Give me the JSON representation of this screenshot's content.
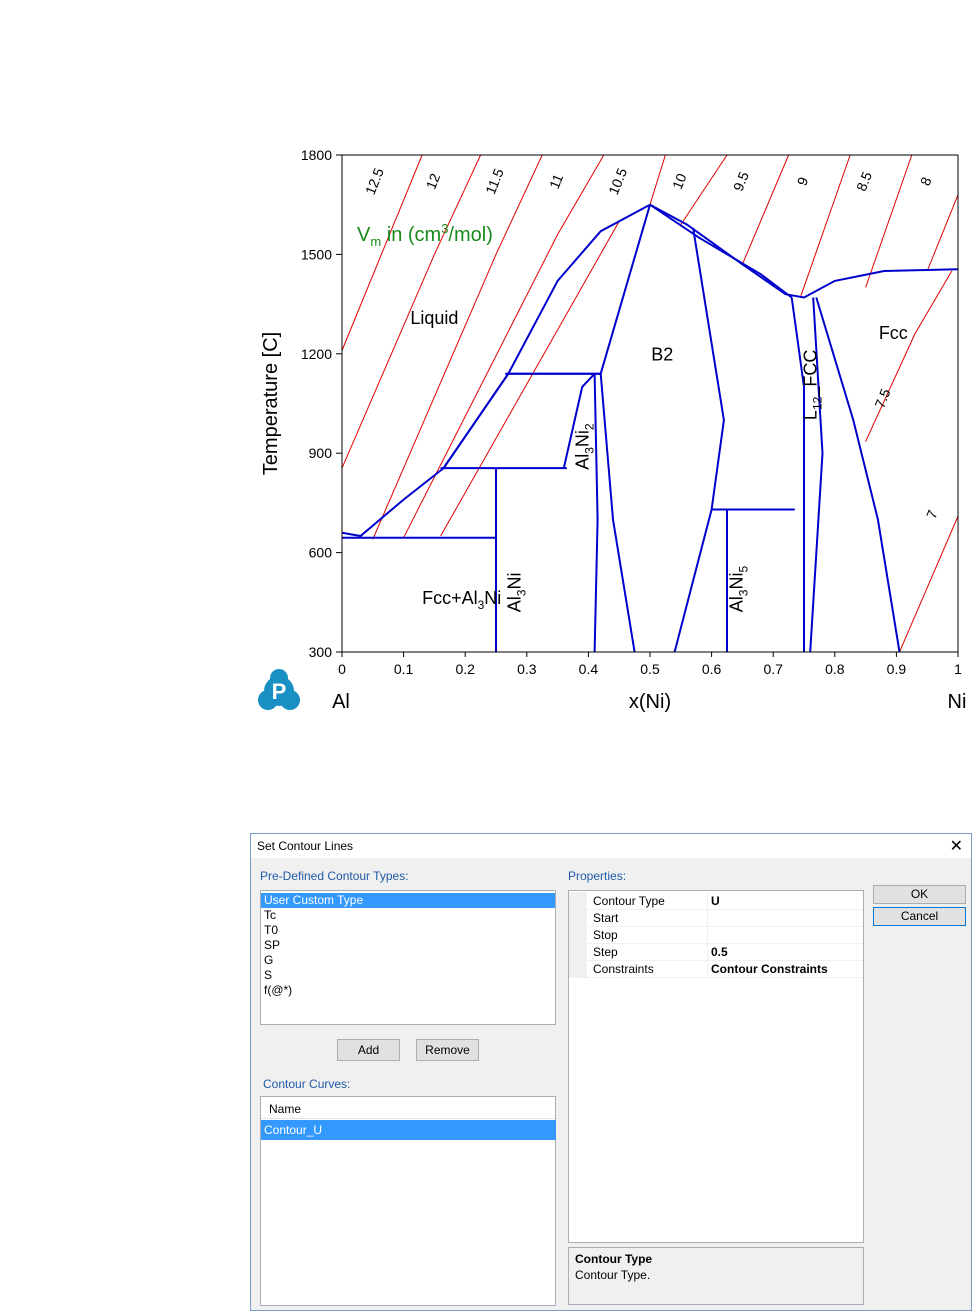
{
  "chart_data": {
    "type": "line",
    "xlabel": "x(Ni)",
    "ylabel": "Temperature [C]",
    "xlim": [
      0,
      1
    ],
    "ylim": [
      300,
      1800
    ],
    "xticks": [
      "0",
      "0.1",
      "0.2",
      "0.3",
      "0.4",
      "0.5",
      "0.6",
      "0.7",
      "0.8",
      "0.9",
      "1"
    ],
    "yticks": [
      "300",
      "600",
      "900",
      "1200",
      "1500",
      "1800"
    ],
    "left_element": "Al",
    "right_element": "Ni",
    "annotation": {
      "prefix": "V",
      "sub": "m",
      "mid": " in (cm",
      "sup": "3",
      "suffix": "/mol)"
    },
    "annotation_color": "#1a8a1a",
    "phase_boundary_color": "#0000cc",
    "contour_color": "#e00000",
    "grid": false,
    "regions": [
      {
        "label": "Liquid",
        "x": 0.15,
        "y": 1290
      },
      {
        "label": "B2",
        "x": 0.52,
        "y": 1180
      },
      {
        "label": "Fcc",
        "x": 0.895,
        "y": 1245
      }
    ],
    "phase_labels": [
      {
        "base": "Fcc+Al",
        "sub": "3",
        "tail": "Ni",
        "x": 0.13,
        "y": 445,
        "rotate": 0
      },
      {
        "base": "Al",
        "sub": "3",
        "tail": "Ni",
        "x": 0.29,
        "y": 420,
        "rotate": -90
      },
      {
        "base": "Al",
        "sub": "3",
        "tail": "Ni",
        "sub2": "2",
        "x": 0.4,
        "y": 850,
        "rotate": -90
      },
      {
        "base": "Al",
        "sub": "3",
        "tail": "Ni",
        "sub2": "5",
        "x": 0.65,
        "y": 420,
        "rotate": -90
      },
      {
        "base": "L",
        "sub": "12",
        "tail": "_FCC",
        "x": 0.77,
        "y": 1000,
        "rotate": -90
      }
    ],
    "contour_labels": [
      {
        "text": "12.5",
        "x": 0.06,
        "y": 1715
      },
      {
        "text": "12",
        "x": 0.155,
        "y": 1715
      },
      {
        "text": "11.5",
        "x": 0.255,
        "y": 1715
      },
      {
        "text": "11",
        "x": 0.355,
        "y": 1715
      },
      {
        "text": "10.5",
        "x": 0.455,
        "y": 1715
      },
      {
        "text": "10",
        "x": 0.555,
        "y": 1715
      },
      {
        "text": "9.5",
        "x": 0.655,
        "y": 1715
      },
      {
        "text": "9",
        "x": 0.755,
        "y": 1715
      },
      {
        "text": "8.5",
        "x": 0.855,
        "y": 1715
      },
      {
        "text": "8",
        "x": 0.955,
        "y": 1715
      },
      {
        "text": "7.5",
        "x": 0.885,
        "y": 1060
      },
      {
        "text": "7",
        "x": 0.965,
        "y": 710
      }
    ],
    "contours": [
      {
        "value": 12.5,
        "points": [
          [
            0,
            1210
          ],
          [
            0.13,
            1800
          ]
        ]
      },
      {
        "value": 12,
        "points": [
          [
            0,
            855
          ],
          [
            0.15,
            1500
          ],
          [
            0.225,
            1800
          ]
        ]
      },
      {
        "value": 11.5,
        "points": [
          [
            0.05,
            640
          ],
          [
            0.25,
            1500
          ],
          [
            0.325,
            1800
          ]
        ]
      },
      {
        "value": 11,
        "points": [
          [
            0.1,
            645
          ],
          [
            0.35,
            1560
          ],
          [
            0.425,
            1800
          ]
        ]
      },
      {
        "value": 10.5,
        "points": [
          [
            0.16,
            650
          ],
          [
            0.45,
            1600
          ],
          [
            0.5,
            1650
          ],
          [
            0.525,
            1800
          ]
        ]
      },
      {
        "value": 10,
        "points": [
          [
            0.55,
            1590
          ],
          [
            0.625,
            1800
          ]
        ]
      },
      {
        "value": 9.5,
        "points": [
          [
            0.65,
            1470
          ],
          [
            0.725,
            1800
          ]
        ]
      },
      {
        "value": 9,
        "points": [
          [
            0.745,
            1375
          ],
          [
            0.825,
            1800
          ]
        ]
      },
      {
        "value": 8.5,
        "points": [
          [
            0.85,
            1400
          ],
          [
            0.925,
            1800
          ]
        ]
      },
      {
        "value": 8,
        "points": [
          [
            0.95,
            1450
          ],
          [
            1,
            1680
          ]
        ]
      },
      {
        "value": 7.5,
        "points": [
          [
            0.85,
            935
          ],
          [
            0.93,
            1260
          ],
          [
            0.99,
            1450
          ]
        ]
      },
      {
        "value": 7,
        "points": [
          [
            0.905,
            300
          ],
          [
            1,
            710
          ]
        ]
      }
    ],
    "boundaries": [
      {
        "name": "liquidus-left",
        "points": [
          [
            0,
            660
          ],
          [
            0.03,
            650
          ],
          [
            0.1,
            760
          ],
          [
            0.165,
            855
          ],
          [
            0.27,
            1140
          ],
          [
            0.35,
            1420
          ],
          [
            0.42,
            1570
          ],
          [
            0.5,
            1650
          ]
        ]
      },
      {
        "name": "solidus-left",
        "points": [
          [
            0.165,
            855
          ],
          [
            0.27,
            1140
          ],
          [
            0.42,
            1140
          ],
          [
            0.5,
            1650
          ]
        ]
      },
      {
        "name": "liquidus-right",
        "points": [
          [
            0.5,
            1650
          ],
          [
            0.56,
            1590
          ],
          [
            0.65,
            1470
          ],
          [
            0.72,
            1380
          ],
          [
            0.75,
            1370
          ],
          [
            0.8,
            1420
          ],
          [
            0.88,
            1450
          ],
          [
            1,
            1455
          ]
        ]
      },
      {
        "name": "solidus-right",
        "points": [
          [
            0.5,
            1650
          ],
          [
            0.58,
            1550
          ],
          [
            0.68,
            1440
          ],
          [
            0.73,
            1370
          ]
        ]
      },
      {
        "name": "eutectic-1140",
        "points": [
          [
            0.265,
            1140
          ],
          [
            0.42,
            1140
          ]
        ]
      },
      {
        "name": "eutectic-855",
        "points": [
          [
            0.16,
            855
          ],
          [
            0.365,
            855
          ]
        ]
      },
      {
        "name": "eutectic-645",
        "points": [
          [
            0,
            645
          ],
          [
            0.25,
            645
          ]
        ]
      },
      {
        "name": "peritectic-730",
        "points": [
          [
            0.6,
            730
          ],
          [
            0.735,
            730
          ]
        ]
      },
      {
        "name": "line-al3ni",
        "points": [
          [
            0.25,
            300
          ],
          [
            0.25,
            855
          ]
        ]
      },
      {
        "name": "line-al3ni5",
        "points": [
          [
            0.625,
            300
          ],
          [
            0.625,
            730
          ]
        ]
      },
      {
        "name": "al3ni2-left",
        "points": [
          [
            0.36,
            855
          ],
          [
            0.39,
            1100
          ],
          [
            0.41,
            1140
          ]
        ]
      },
      {
        "name": "al3ni2-right",
        "points": [
          [
            0.41,
            1140
          ],
          [
            0.415,
            700
          ],
          [
            0.41,
            300
          ]
        ]
      },
      {
        "name": "b2-left",
        "points": [
          [
            0.42,
            1140
          ],
          [
            0.44,
            700
          ],
          [
            0.475,
            300
          ]
        ]
      },
      {
        "name": "b2-right",
        "points": [
          [
            0.57,
            1580
          ],
          [
            0.62,
            1000
          ],
          [
            0.6,
            730
          ],
          [
            0.54,
            300
          ]
        ]
      },
      {
        "name": "l12-left",
        "points": [
          [
            0.73,
            1370
          ],
          [
            0.75,
            1100
          ],
          [
            0.75,
            300
          ]
        ]
      },
      {
        "name": "l12-right",
        "points": [
          [
            0.765,
            1370
          ],
          [
            0.78,
            900
          ],
          [
            0.76,
            300
          ]
        ]
      },
      {
        "name": "fcc-left",
        "points": [
          [
            0.77,
            1370
          ],
          [
            0.83,
            1000
          ],
          [
            0.87,
            700
          ],
          [
            0.905,
            300
          ]
        ]
      }
    ]
  },
  "dialog": {
    "title": "Set Contour Lines",
    "close_glyph": "✕",
    "predefined_label": "Pre-Defined Contour Types:",
    "predefined_items": [
      "User Custom Type",
      "Tc",
      "T0",
      "SP",
      "G",
      "S",
      "f(@*)"
    ],
    "add_label": "Add",
    "remove_label": "Remove",
    "curves_label": "Contour Curves:",
    "curves_header": "Name",
    "curves_items": [
      "Contour_U"
    ],
    "properties_label": "Properties:",
    "properties": [
      {
        "name": "Contour Type",
        "value": "U"
      },
      {
        "name": "Start",
        "value": ""
      },
      {
        "name": "Stop",
        "value": ""
      },
      {
        "name": "Step",
        "value": "0.5"
      },
      {
        "name": "Constraints",
        "value": "Contour Constraints"
      }
    ],
    "ok_label": "OK",
    "cancel_label": "Cancel",
    "description_title": "Contour Type",
    "description_text": "Contour Type."
  },
  "logo": {
    "letter": "P",
    "color": "#1a8fc4"
  }
}
